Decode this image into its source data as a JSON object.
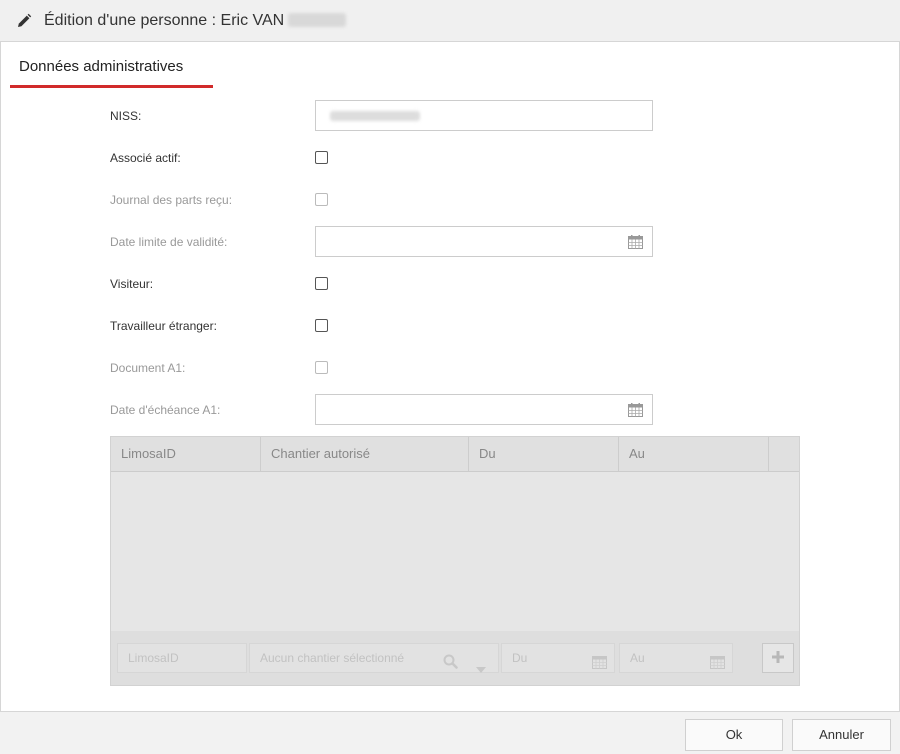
{
  "header": {
    "title": "Édition d'une personne : Eric VAN",
    "icon": "pencil-icon"
  },
  "tab": {
    "label": "Données administratives",
    "accent": "#d12a2a"
  },
  "form": {
    "niss_label": "NISS:",
    "associe_label": "Associé actif:",
    "journal_label": "Journal des parts reçu:",
    "date_limite_label": "Date limite de validité:",
    "visiteur_label": "Visiteur:",
    "travailleur_label": "Travailleur étranger:",
    "document_label": "Document A1:",
    "date_echeance_label": "Date d'échéance A1:"
  },
  "grid": {
    "columns": [
      "LimosaID",
      "Chantier autorisé",
      "Du",
      "Au"
    ],
    "footer": {
      "limosa_placeholder": "LimosaID",
      "chantier_placeholder": "Aucun chantier sélectionné",
      "du_placeholder": "Du",
      "au_placeholder": "Au"
    }
  },
  "buttons": {
    "ok": "Ok",
    "cancel": "Annuler"
  }
}
